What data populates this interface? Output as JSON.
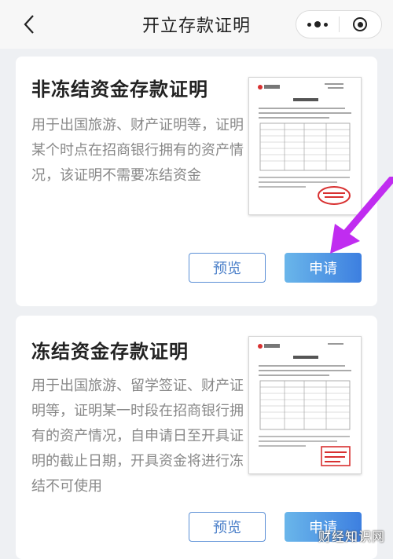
{
  "navbar": {
    "title": "开立存款证明"
  },
  "cards": [
    {
      "title": "非冻结资金存款证明",
      "description": "用于出国旅游、财产证明等，证明某个时点在招商银行拥有的资产情况，该证明不需要冻结资金",
      "preview_label": "预览",
      "apply_label": "申请"
    },
    {
      "title": "冻结资金存款证明",
      "description": "用于出国旅游、留学签证、财产证明等，证明某一时段在招商银行拥有的资产情况，自申请日至开具证明的截止日期，开具资金将进行冻结不可使用",
      "preview_label": "预览",
      "apply_label": "申请"
    }
  ],
  "colors": {
    "accent": "#3d7fe0",
    "arrow": "#c02cf0",
    "stamp": "#d83030"
  },
  "watermark": "财经知识网"
}
